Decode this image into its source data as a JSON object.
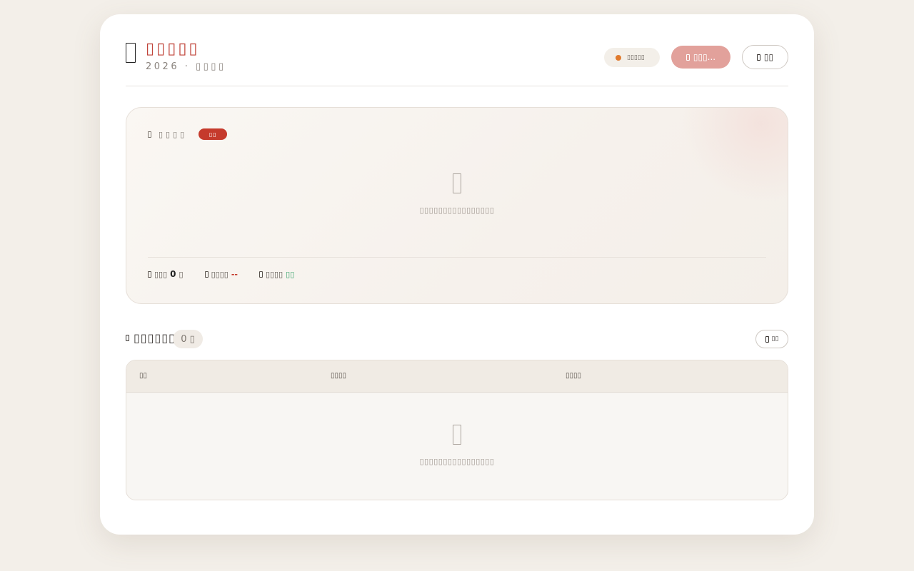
{
  "header": {
    "title": "▯▯▯▯▯",
    "subtitle": "2026 · ▯▯▯▯",
    "status_label": "▯▯▯▯▯",
    "primary_button_label": "▯▯▯...",
    "secondary_button_label": "▯▯"
  },
  "panel": {
    "heading": "▯▯▯▯",
    "badge": "▯▯",
    "empty_text": "▯▯▯▯▯▯▯▯▯▯▯▯▯▯▯▯",
    "stats": [
      {
        "label": "▯▯▯",
        "value": "0",
        "unit": "▯"
      },
      {
        "label": "▯▯▯▯",
        "value": "--"
      },
      {
        "label": "▯▯▯▯",
        "value": "▯▯"
      }
    ]
  },
  "section": {
    "title": "▯▯▯▯▯▯",
    "count": "0 ▯",
    "button_label": "▯▯"
  },
  "table": {
    "columns": [
      "▯▯",
      "▯▯▯▯",
      "▯▯▯▯"
    ],
    "empty_text": "▯▯▯▯▯▯▯▯▯▯▯▯▯▯▯▯"
  },
  "colors": {
    "accent_red": "#c0443a",
    "badge_red": "#c53a2c",
    "primary_button": "#e2a19b",
    "status_dot": "#e07a2e",
    "positive_green": "#3aa36b",
    "background": "#f3efe9"
  }
}
